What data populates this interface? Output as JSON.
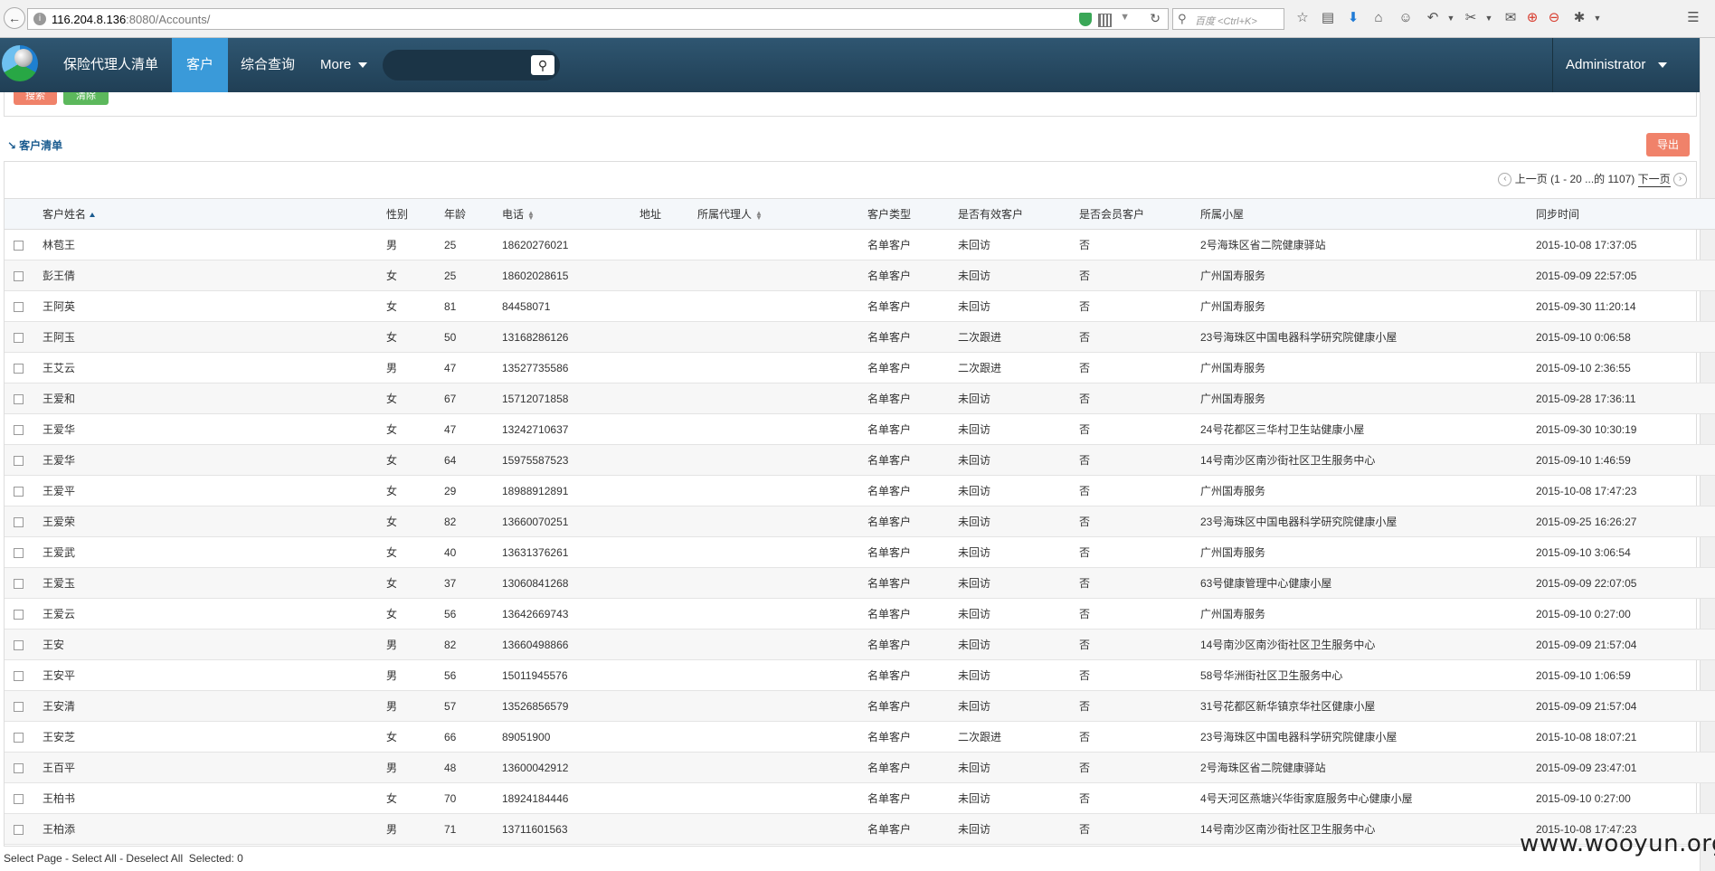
{
  "browser": {
    "url_host": "116.204.8.136",
    "url_rest": ":8080/Accounts/",
    "search_placeholder": "百度 <Ctrl+K>"
  },
  "nav": {
    "items": [
      "保险代理人清单",
      "客户",
      "综合查询",
      "More"
    ],
    "active_index": 1,
    "user": "Administrator"
  },
  "filter": {
    "search_label": "搜索",
    "clear_label": "清除"
  },
  "section_title": "客户清单",
  "export_label": "导出",
  "pager": {
    "prev": "上一页",
    "range": "(1 - 20 ...的 1107)",
    "next": "下一页"
  },
  "columns": [
    "客户姓名",
    "性别",
    "年龄",
    "电话",
    "地址",
    "所属代理人",
    "客户类型",
    "是否有效客户",
    "是否会员客户",
    "所属小屋",
    "同步时间"
  ],
  "rows": [
    [
      "林苞王",
      "男",
      "25",
      "18620276021",
      "",
      "",
      "名单客户",
      "未回访",
      "否",
      "2号海珠区省二院健康驿站",
      "2015-10-08 17:37:05"
    ],
    [
      "彭王倩",
      "女",
      "25",
      "18602028615",
      "",
      "",
      "名单客户",
      "未回访",
      "否",
      "广州国寿服务",
      "2015-09-09 22:57:05"
    ],
    [
      "王阿英",
      "女",
      "81",
      "84458071",
      "",
      "",
      "名单客户",
      "未回访",
      "否",
      "广州国寿服务",
      "2015-09-30 11:20:14"
    ],
    [
      "王阿玉",
      "女",
      "50",
      "13168286126",
      "",
      "",
      "名单客户",
      "二次跟进",
      "否",
      "23号海珠区中国电器科学研究院健康小屋",
      "2015-09-10 0:06:58"
    ],
    [
      "王艾云",
      "男",
      "47",
      "13527735586",
      "",
      "",
      "名单客户",
      "二次跟进",
      "否",
      "广州国寿服务",
      "2015-09-10 2:36:55"
    ],
    [
      "王爱和",
      "女",
      "67",
      "15712071858",
      "",
      "",
      "名单客户",
      "未回访",
      "否",
      "广州国寿服务",
      "2015-09-28 17:36:11"
    ],
    [
      "王爱华",
      "女",
      "47",
      "13242710637",
      "",
      "",
      "名单客户",
      "未回访",
      "否",
      "24号花都区三华村卫生站健康小屋",
      "2015-09-30 10:30:19"
    ],
    [
      "王爱华",
      "女",
      "64",
      "15975587523",
      "",
      "",
      "名单客户",
      "未回访",
      "否",
      "14号南沙区南沙街社区卫生服务中心",
      "2015-09-10 1:46:59"
    ],
    [
      "王爱平",
      "女",
      "29",
      "18988912891",
      "",
      "",
      "名单客户",
      "未回访",
      "否",
      "广州国寿服务",
      "2015-10-08 17:47:23"
    ],
    [
      "王爱荣",
      "女",
      "82",
      "13660070251",
      "",
      "",
      "名单客户",
      "未回访",
      "否",
      "23号海珠区中国电器科学研究院健康小屋",
      "2015-09-25 16:26:27"
    ],
    [
      "王爱武",
      "女",
      "40",
      "13631376261",
      "",
      "",
      "名单客户",
      "未回访",
      "否",
      "广州国寿服务",
      "2015-09-10 3:06:54"
    ],
    [
      "王爱玉",
      "女",
      "37",
      "13060841268",
      "",
      "",
      "名单客户",
      "未回访",
      "否",
      "63号健康管理中心健康小屋",
      "2015-09-09 22:07:05"
    ],
    [
      "王爱云",
      "女",
      "56",
      "13642669743",
      "",
      "",
      "名单客户",
      "未回访",
      "否",
      "广州国寿服务",
      "2015-09-10 0:27:00"
    ],
    [
      "王安",
      "男",
      "82",
      "13660498866",
      "",
      "",
      "名单客户",
      "未回访",
      "否",
      "14号南沙区南沙街社区卫生服务中心",
      "2015-09-09 21:57:04"
    ],
    [
      "王安平",
      "男",
      "56",
      "15011945576",
      "",
      "",
      "名单客户",
      "未回访",
      "否",
      "58号华洲街社区卫生服务中心",
      "2015-09-10 1:06:59"
    ],
    [
      "王安清",
      "男",
      "57",
      "13526856579",
      "",
      "",
      "名单客户",
      "未回访",
      "否",
      "31号花都区新华镇京华社区健康小屋",
      "2015-09-09 21:57:04"
    ],
    [
      "王安芝",
      "女",
      "66",
      "89051900",
      "",
      "",
      "名单客户",
      "二次跟进",
      "否",
      "23号海珠区中国电器科学研究院健康小屋",
      "2015-10-08 18:07:21"
    ],
    [
      "王百平",
      "男",
      "48",
      "13600042912",
      "",
      "",
      "名单客户",
      "未回访",
      "否",
      "2号海珠区省二院健康驿站",
      "2015-09-09 23:47:01"
    ],
    [
      "王柏书",
      "女",
      "70",
      "18924184446",
      "",
      "",
      "名单客户",
      "未回访",
      "否",
      "4号天河区燕塘兴华街家庭服务中心健康小屋",
      "2015-09-10 0:27:00"
    ],
    [
      "王柏添",
      "男",
      "71",
      "13711601563",
      "",
      "",
      "名单客户",
      "未回访",
      "否",
      "14号南沙区南沙街社区卫生服务中心",
      "2015-10-08 17:47:23"
    ]
  ],
  "footer": {
    "select_page": "Select Page",
    "select_all": "Select All",
    "deselect_all": "Deselect All",
    "selected": "Selected: 0"
  },
  "watermark": "www.wooyun.org"
}
